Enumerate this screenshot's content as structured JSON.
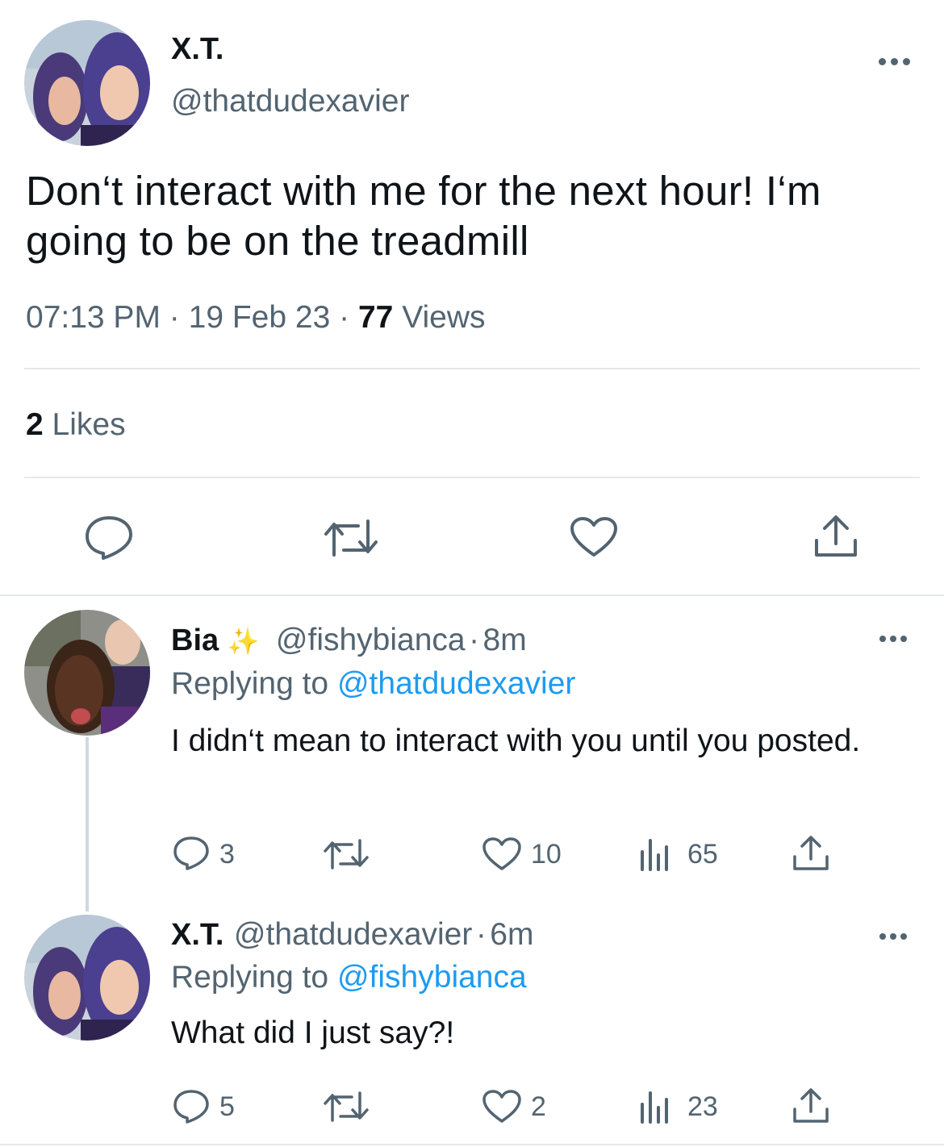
{
  "main_tweet": {
    "name": "X.T.",
    "handle": "@thatdudexavier",
    "text": "Don‘t interact with me for the next hour! I‘m going to be on the treadmill",
    "time": "07:13 PM",
    "date": "19 Feb 23",
    "views_count": "77",
    "views_label": "Views",
    "likes_count": "2",
    "likes_label": "Likes"
  },
  "replies": [
    {
      "name": "Bia",
      "emoji": "✨",
      "handle": "@fishybianca",
      "age": "8m",
      "replying_to_label": "Replying to",
      "replying_to_handle": "@thatdudexavier",
      "text": "I didn‘t mean to interact with you until you posted.",
      "replies": "3",
      "likes": "10",
      "views": "65"
    },
    {
      "name": "X.T.",
      "handle": "@thatdudexavier",
      "age": "6m",
      "replying_to_label": "Replying to",
      "replying_to_handle": "@fishybianca",
      "text": "What did I just say?!",
      "replies": "5",
      "likes": "2",
      "views": "23"
    }
  ],
  "separator": "·",
  "icons": [
    "reply-icon",
    "retweet-icon",
    "like-icon",
    "share-icon",
    "views-icon",
    "more-icon",
    "sparkles-icon"
  ],
  "colors": {
    "text": "#0f1419",
    "secondary": "#536471",
    "link": "#1d9bf0",
    "divider": "#e6e8ea"
  }
}
